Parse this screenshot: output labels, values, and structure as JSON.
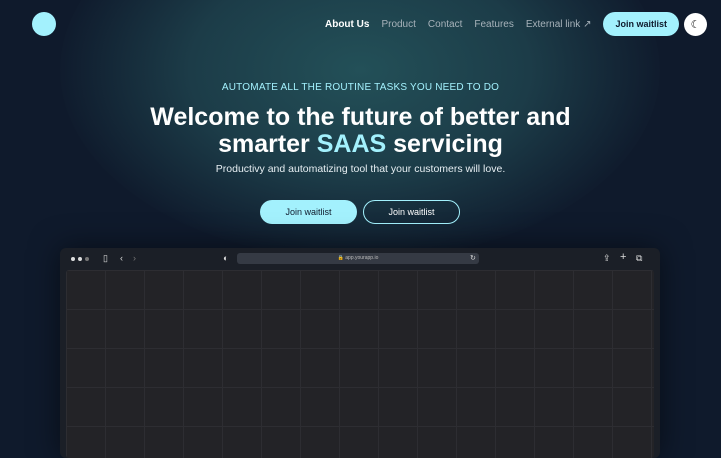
{
  "nav": {
    "items": [
      {
        "label": "About Us"
      },
      {
        "label": "Product"
      },
      {
        "label": "Contact"
      },
      {
        "label": "Features"
      },
      {
        "label": "External link"
      }
    ],
    "cta": "Join waitlist"
  },
  "hero": {
    "eyebrow": "AUTOMATE ALL THE ROUTINE TASKS YOU NEED TO DO",
    "title_line1": "Welcome to the future of better and",
    "title_pre": "smarter ",
    "title_accent": "SAAS",
    "title_post": " servicing",
    "subtitle": "Productivy and automatizing tool that your customers will love.",
    "cta_primary": "Join waitlist",
    "cta_secondary": "Join waitlist"
  },
  "browser": {
    "url": "app.yourapp.io"
  },
  "colors": {
    "accent": "#a3f1fd",
    "background": "#0f1a2c"
  }
}
